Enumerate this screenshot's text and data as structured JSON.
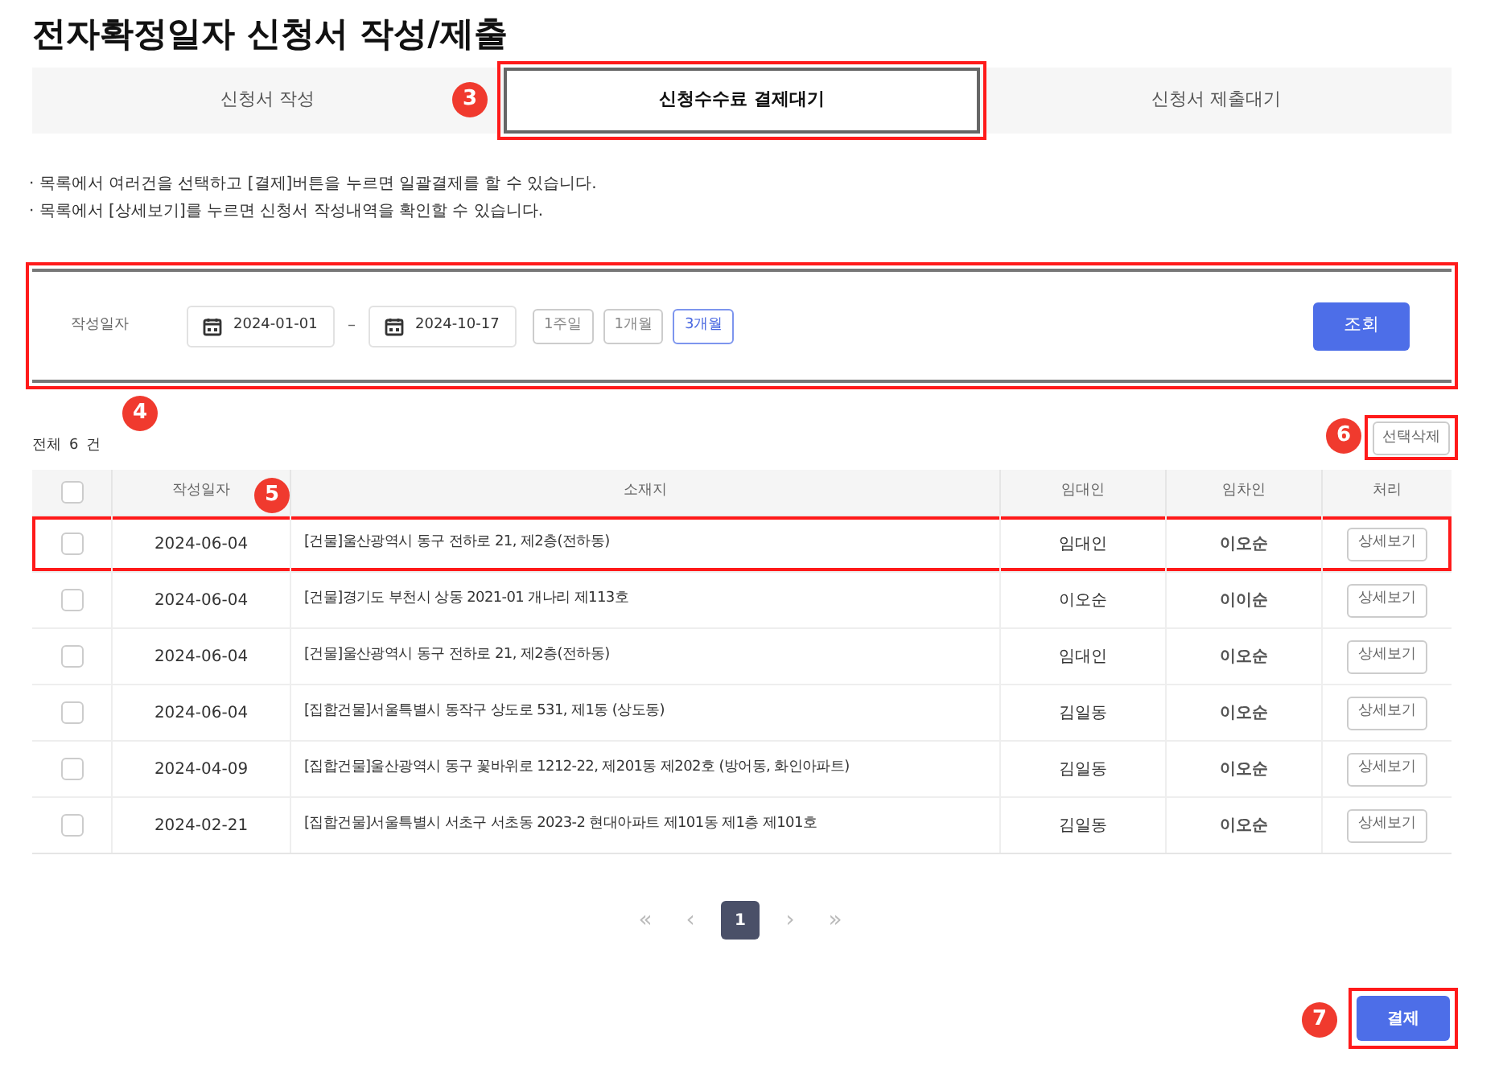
{
  "title": "전자확정일자 신청서 작성/제출",
  "tabs": [
    {
      "label": "신청서 작성",
      "selected": false,
      "highlighted": false
    },
    {
      "label": "신청수수료 결제대기",
      "selected": true,
      "highlighted": true,
      "marker": "3"
    },
    {
      "label": "신청서 제출대기",
      "selected": false,
      "highlighted": false
    }
  ],
  "notes": [
    "· 목록에서 여러건을 선택하고 [결제]버튼을 누르면 일괄결제를 할 수 있습니다.",
    "· 목록에서 [상세보기]를 누르면 신청서 작성내역을 확인할 수 있습니다."
  ],
  "filter": {
    "highlighted": true,
    "marker": "4",
    "label": "작성일자",
    "start": "2024-01-01",
    "separator": "–",
    "end": "2024-10-17",
    "ranges": [
      {
        "label": "1주일",
        "selected": false
      },
      {
        "label": "1개월",
        "selected": false
      },
      {
        "label": "3개월",
        "selected": true
      }
    ],
    "search_button": "조회"
  },
  "count": {
    "prefix": "전체",
    "value": "6",
    "suffix": "건"
  },
  "delete_button": {
    "label": "선택삭제",
    "highlighted": true,
    "marker": "6"
  },
  "table": {
    "header_checked": false,
    "columns": [
      {
        "label": "작성일자",
        "marker": "5"
      },
      {
        "label": "소재지"
      },
      {
        "label": "임대인"
      },
      {
        "label": "임차인"
      },
      {
        "label": "처리"
      }
    ],
    "rows": [
      {
        "checked": false,
        "highlighted": true,
        "date": "2024-06-04",
        "address": "[건물]울산광역시 동구 전하로 21, 제2층(전하동)",
        "landlord": "임대인",
        "tenant": "이오순",
        "action": "상세보기"
      },
      {
        "checked": false,
        "highlighted": false,
        "date": "2024-06-04",
        "address": "[건물]경기도 부천시 상동 2021-01 개나리 제113호",
        "landlord": "이오순",
        "tenant": "이이순",
        "action": "상세보기"
      },
      {
        "checked": false,
        "highlighted": false,
        "date": "2024-06-04",
        "address": "[건물]울산광역시 동구 전하로 21, 제2층(전하동)",
        "landlord": "임대인",
        "tenant": "이오순",
        "action": "상세보기"
      },
      {
        "checked": false,
        "highlighted": false,
        "date": "2024-06-04",
        "address": "[집합건물]서울특별시 동작구 상도로 531, 제1동 (상도동)",
        "landlord": "김일동",
        "tenant": "이오순",
        "action": "상세보기"
      },
      {
        "checked": false,
        "highlighted": false,
        "date": "2024-04-09",
        "address": "[집합건물]울산광역시 동구 꽃바위로 1212-22, 제201동 제202호 (방어동, 화인아파트)",
        "landlord": "김일동",
        "tenant": "이오순",
        "action": "상세보기"
      },
      {
        "checked": false,
        "highlighted": false,
        "date": "2024-02-21",
        "address": "[집합건물]서울특별시 서초구 서초동 2023-2 현대아파트 제101동 제1층 제101호",
        "landlord": "김일동",
        "tenant": "이오순",
        "action": "상세보기"
      }
    ]
  },
  "pagination": [
    {
      "label": "«",
      "kind": "nav",
      "selected": false
    },
    {
      "label": "‹",
      "kind": "nav",
      "selected": false
    },
    {
      "label": "1",
      "kind": "page",
      "selected": true
    },
    {
      "label": "›",
      "kind": "nav",
      "selected": false
    },
    {
      "label": "»",
      "kind": "nav",
      "selected": false
    }
  ],
  "pay_button": {
    "label": "결제",
    "highlighted": true,
    "marker": "7"
  }
}
